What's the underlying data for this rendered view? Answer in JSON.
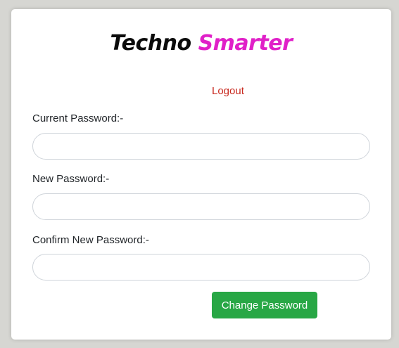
{
  "brand": {
    "word1": "Techno",
    "word2": "Smarter",
    "word1_color": "#0b0b0b",
    "word2_color": "#e020c8"
  },
  "logout": {
    "label": "Logout",
    "color": "#c8281e"
  },
  "form": {
    "current_password": {
      "label": "Current Password:-",
      "value": "",
      "placeholder": ""
    },
    "new_password": {
      "label": "New Password:-",
      "value": "",
      "placeholder": ""
    },
    "confirm_password": {
      "label": "Confirm New Password:-",
      "value": "",
      "placeholder": ""
    }
  },
  "submit": {
    "label": "Change Password",
    "color": "#28a745"
  }
}
